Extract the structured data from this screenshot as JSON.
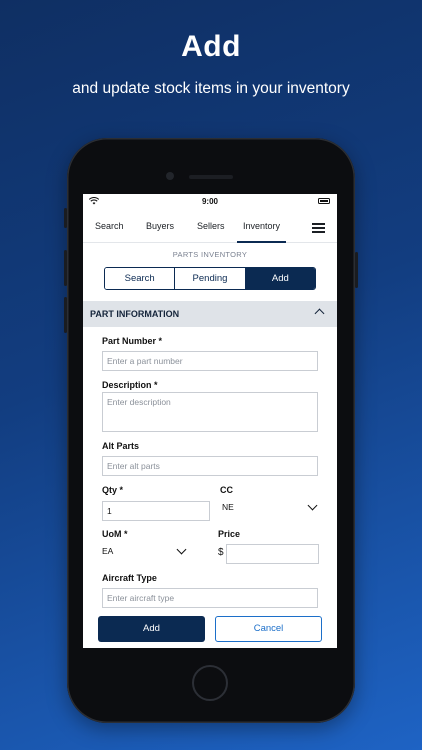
{
  "hero": {
    "title": "Add",
    "subtitle": "and update stock items in your inventory"
  },
  "status_bar": {
    "time": "9:00",
    "icons": [
      "wifi-icon",
      "battery-icon"
    ]
  },
  "nav": {
    "items": [
      {
        "label": "Search"
      },
      {
        "label": "Buyers"
      },
      {
        "label": "Sellers"
      },
      {
        "label": "Inventory",
        "active": true
      }
    ],
    "menu_icon": "hamburger-menu-icon"
  },
  "section_caption": "PARTS INVENTORY",
  "segmented": {
    "options": [
      "Search",
      "Pending",
      "Add"
    ],
    "selected": "Add"
  },
  "accordion": {
    "title": "PART INFORMATION",
    "icon": "chevron-up-icon"
  },
  "form": {
    "part_number": {
      "label": "Part Number *",
      "placeholder": "Enter a part number",
      "value": ""
    },
    "description": {
      "label": "Description *",
      "placeholder": "Enter description",
      "value": ""
    },
    "alt_parts": {
      "label": "Alt Parts",
      "placeholder": "Enter alt parts",
      "value": ""
    },
    "qty": {
      "label": "Qty *",
      "value": "1"
    },
    "cc": {
      "label": "CC",
      "value": "NE"
    },
    "uom": {
      "label": "UoM *",
      "value": "EA"
    },
    "price": {
      "label": "Price",
      "currency": "$",
      "value": ""
    },
    "aircraft_type": {
      "label": "Aircraft Type",
      "placeholder": "Enter aircraft type",
      "value": ""
    }
  },
  "actions": {
    "add_label": "Add",
    "cancel_label": "Cancel"
  },
  "colors": {
    "primary": "#0b2a52",
    "accent": "#1c6fc9",
    "background_gradient_start": "#0f2f63",
    "background_gradient_end": "#1e63c4"
  }
}
